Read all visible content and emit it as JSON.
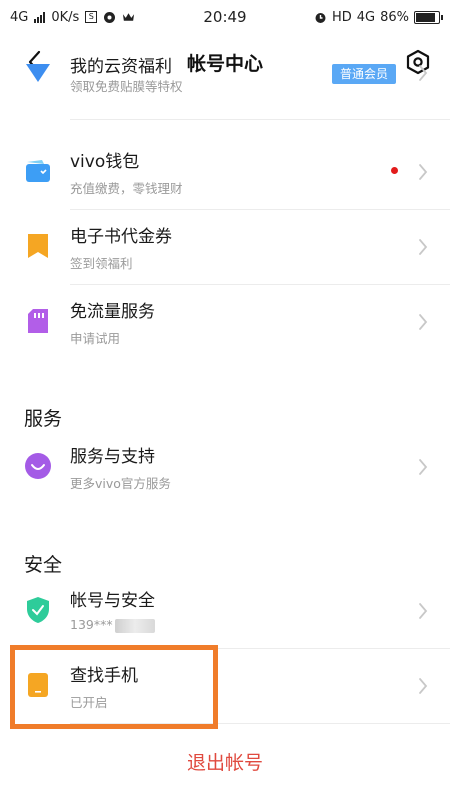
{
  "status_bar": {
    "network": "4G",
    "speed": "0K/s",
    "time": "20:49",
    "hd": "HD",
    "network2": "4G",
    "battery": "86%",
    "battery_level": 0.86
  },
  "nav": {
    "title": "帐号中心",
    "back_icon": "chevron-left-icon",
    "settings_icon": "hexagon-settings-icon"
  },
  "items": {
    "cloud": {
      "title": "我的云资福利",
      "subtitle": "领取免费贴膜等特权",
      "badge": "普通会员"
    },
    "wallet": {
      "title": "vivo钱包",
      "subtitle": "充值缴费，零钱理财"
    },
    "ebook": {
      "title": "电子书代金券",
      "subtitle": "签到领福利"
    },
    "traffic": {
      "title": "免流量服务",
      "subtitle": "申请试用"
    },
    "support": {
      "title": "服务与支持",
      "subtitle": "更多vivo官方服务"
    },
    "security": {
      "title": "帐号与安全",
      "subtitle": "139***"
    },
    "findphone": {
      "title": "查找手机",
      "subtitle": "已开启"
    }
  },
  "sections": {
    "service": "服务",
    "safety": "安全"
  },
  "logout_label": "退出帐号",
  "colors": {
    "accent_red": "#e04a3f",
    "highlight_orange": "#f07c2a",
    "badge_blue": "#5aa8f5"
  }
}
